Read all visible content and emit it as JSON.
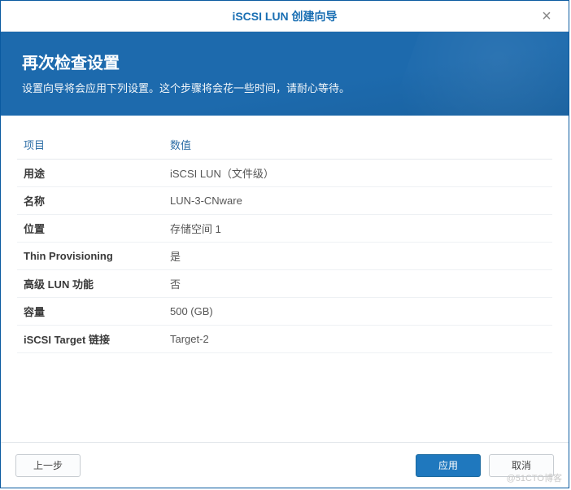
{
  "titlebar": {
    "title": "iSCSI LUN 创建向导"
  },
  "banner": {
    "heading": "再次检查设置",
    "subheading": "设置向导将会应用下列设置。这个步骤将会花一些时间，请耐心等待。"
  },
  "table": {
    "header_key": "项目",
    "header_val": "数值",
    "rows": [
      {
        "key": "用途",
        "val": "iSCSI LUN（文件级）"
      },
      {
        "key": "名称",
        "val": "LUN-3-CNware"
      },
      {
        "key": "位置",
        "val": "存储空间 1"
      },
      {
        "key": "Thin Provisioning",
        "val": "是"
      },
      {
        "key": "高级 LUN 功能",
        "val": "否"
      },
      {
        "key": "容量",
        "val": "500 (GB)"
      },
      {
        "key": "iSCSI Target 链接",
        "val": "Target-2"
      }
    ]
  },
  "footer": {
    "back": "上一步",
    "apply": "应用",
    "cancel": "取消"
  },
  "watermark": "@51CTO博客"
}
